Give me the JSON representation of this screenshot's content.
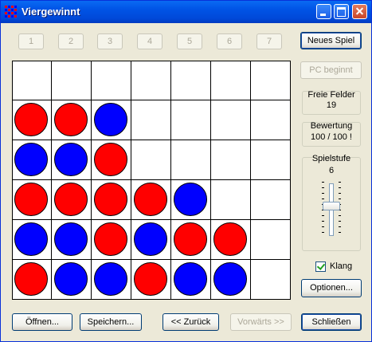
{
  "window": {
    "title": "Viergewinnt"
  },
  "column_buttons": [
    "1",
    "2",
    "3",
    "4",
    "5",
    "6",
    "7"
  ],
  "board": {
    "colors": {
      "red": "#ff0000",
      "blue": "#0000ff"
    },
    "rows": [
      [
        "",
        "",
        "",
        "",
        "",
        "",
        ""
      ],
      [
        "red",
        "red",
        "blue",
        "",
        "",
        "",
        ""
      ],
      [
        "blue",
        "blue",
        "red",
        "",
        "",
        "",
        ""
      ],
      [
        "red",
        "red",
        "red",
        "red",
        "blue",
        "",
        ""
      ],
      [
        "blue",
        "blue",
        "red",
        "blue",
        "red",
        "red",
        ""
      ],
      [
        "red",
        "blue",
        "blue",
        "red",
        "blue",
        "blue",
        ""
      ]
    ]
  },
  "side": {
    "new_game": "Neues Spiel",
    "pc_starts": "PC beginnt",
    "free_fields_label": "Freie Felder",
    "free_fields_value": "19",
    "rating_label": "Bewertung",
    "rating_value": "100 / 100 !",
    "level_label": "Spielstufe",
    "level_value": "6",
    "level_slider_fraction": 0.42,
    "sound_label": "Klang",
    "sound_checked": true,
    "options": "Optionen..."
  },
  "bottom": {
    "open": "Öffnen...",
    "save": "Speichern...",
    "back": "<< Zurück",
    "forward": "Vorwärts >>",
    "close": "Schließen"
  }
}
